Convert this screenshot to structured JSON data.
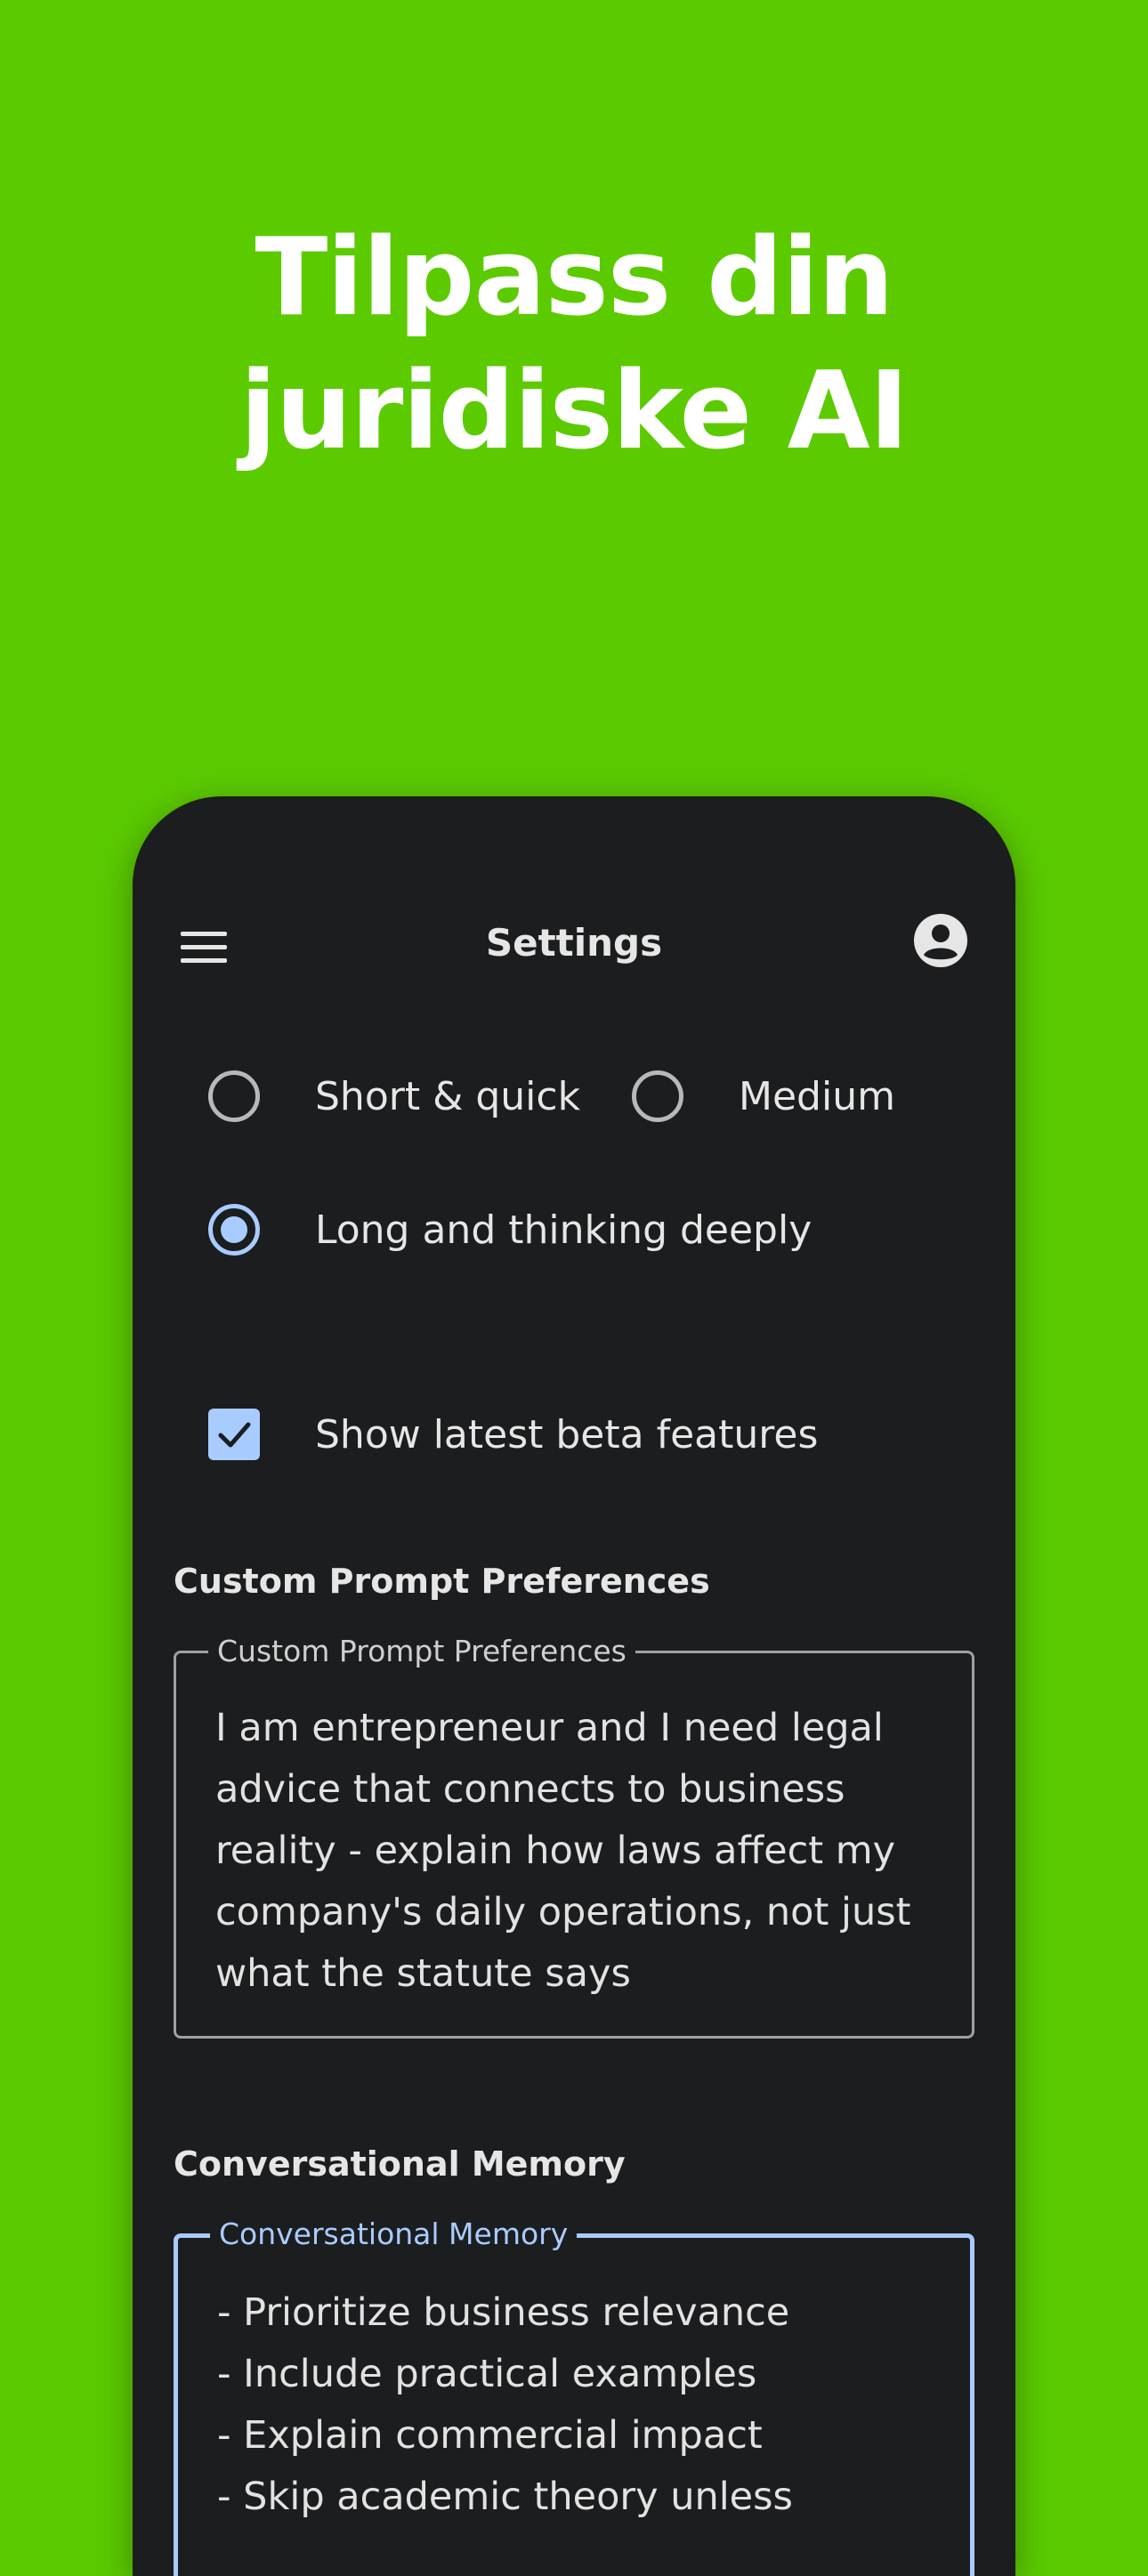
{
  "promo": {
    "title_line1": "Tilpass din",
    "title_line2": "juridiske AI"
  },
  "appbar": {
    "title": "Settings",
    "menu_icon": "menu-icon",
    "profile_icon": "account-circle-icon"
  },
  "response_length": {
    "options": [
      {
        "label": "Short & quick",
        "selected": false
      },
      {
        "label": "Medium",
        "selected": false
      },
      {
        "label": "Long and thinking deeply",
        "selected": true
      }
    ]
  },
  "beta": {
    "label": "Show latest beta features",
    "checked": true
  },
  "custom_prompt": {
    "heading": "Custom Prompt Preferences",
    "field_label": "Custom Prompt Preferences",
    "lines": [
      "I am entrepreneur and I  need legal",
      "advice that connects to business",
      "reality - explain how laws affect my",
      "company's daily operations, not just",
      "what the statute says"
    ]
  },
  "memory": {
    "heading": "Conversational Memory",
    "field_label": "Conversational Memory",
    "lines": [
      "- Prioritize business relevance",
      "- Include practical examples",
      "- Explain commercial impact",
      "- Skip academic theory unless"
    ]
  },
  "colors": {
    "background": "#5BCB00",
    "phone": "#1C1D1F",
    "accent": "#A8CCFF"
  }
}
